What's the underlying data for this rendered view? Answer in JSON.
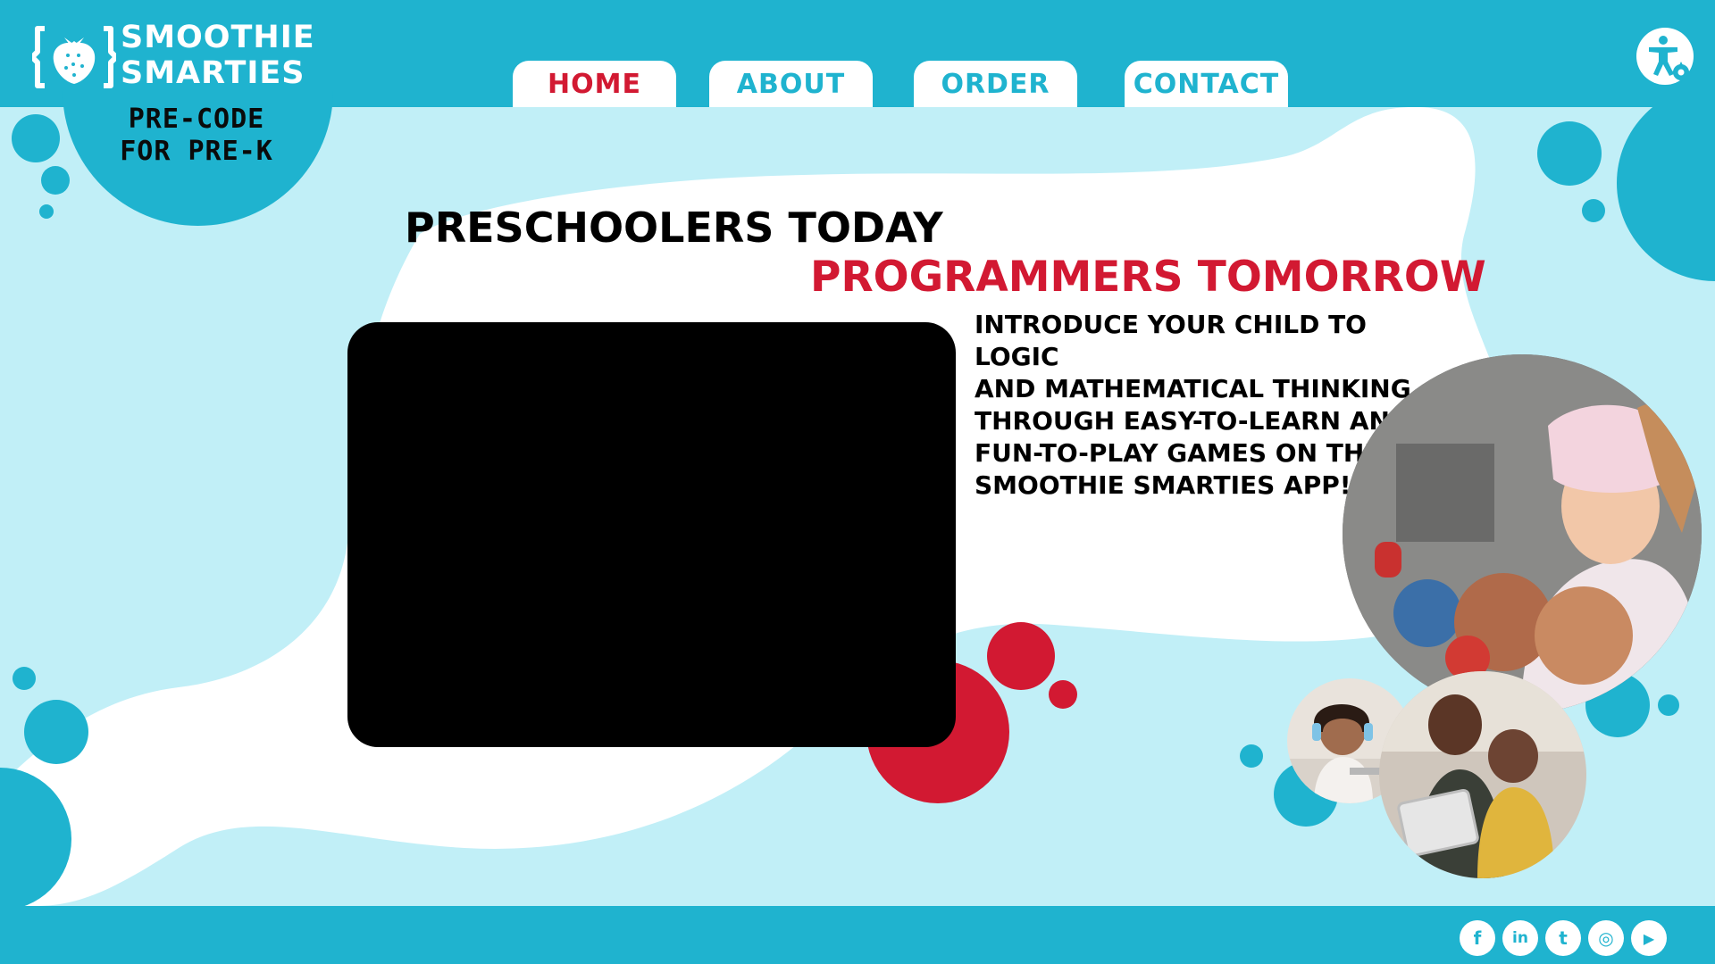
{
  "brand": {
    "name_line1": "SMOOTHIE",
    "name_line2": "SMARTIES",
    "tagline_line1": "PRE-CODE",
    "tagline_line2": "FOR PRE-K",
    "logo_icon": "strawberry-brackets-icon"
  },
  "nav": {
    "items": [
      {
        "label": "HOME",
        "active": true
      },
      {
        "label": "ABOUT",
        "active": false
      },
      {
        "label": "ORDER",
        "active": false
      },
      {
        "label": "CONTACT",
        "active": false
      }
    ]
  },
  "accessibility": {
    "icon": "accessibility-settings-icon"
  },
  "hero": {
    "headline_line1": "PRESCHOOLERS TODAY",
    "headline_line2": "PROGRAMMERS TOMORROW",
    "description_lines": [
      "INTRODUCE YOUR CHILD TO LOGIC",
      "AND MATHEMATICAL THINKING",
      "THROUGH EASY-TO-LEARN AND",
      "FUN-TO-PLAY GAMES ON THE",
      "SMOOTHIE SMARTIES APP!"
    ]
  },
  "media": {
    "video": "video-player",
    "photos": [
      "child-vr-headset-photo",
      "girl-headphones-laptop-photo",
      "mother-daughter-tablet-photo"
    ]
  },
  "footer": {
    "social": [
      {
        "icon": "facebook-icon",
        "glyph": "f"
      },
      {
        "icon": "linkedin-icon",
        "glyph": "in"
      },
      {
        "icon": "twitter-icon",
        "glyph": "t"
      },
      {
        "icon": "instagram-icon",
        "glyph": "◎"
      },
      {
        "icon": "youtube-icon",
        "glyph": "▶"
      }
    ]
  },
  "colors": {
    "primary": "#1fb3cf",
    "light_bg": "#c1eff7",
    "accent": "#d21932",
    "text": "#000000",
    "white": "#ffffff"
  }
}
